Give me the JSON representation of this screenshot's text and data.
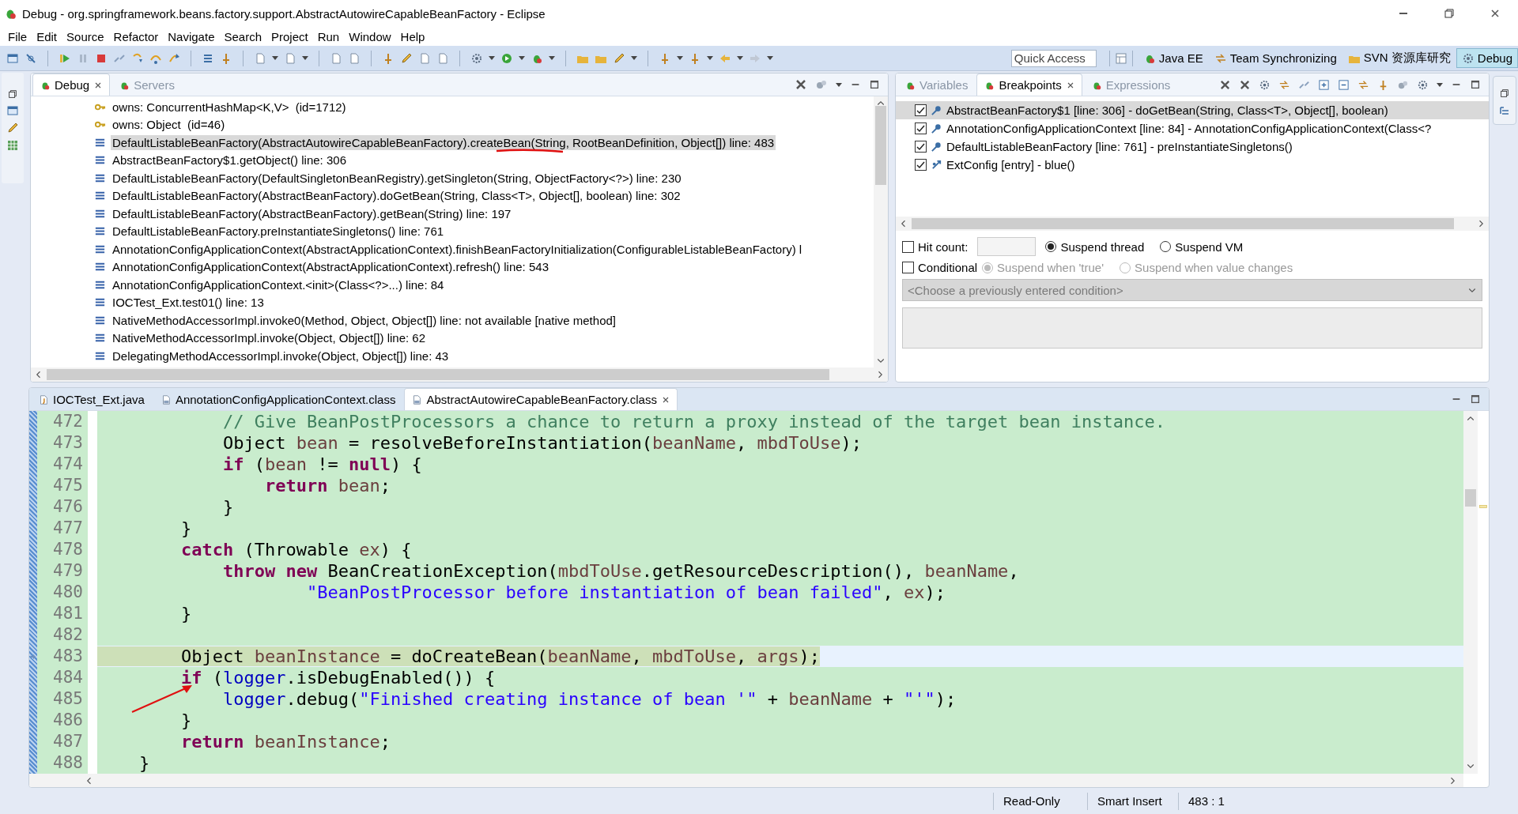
{
  "window": {
    "title": "Debug - org.springframework.beans.factory.support.AbstractAutowireCapableBeanFactory - Eclipse"
  },
  "menu": [
    "File",
    "Edit",
    "Source",
    "Refactor",
    "Navigate",
    "Search",
    "Project",
    "Run",
    "Window",
    "Help"
  ],
  "toolbar": {
    "quick_access": {
      "placeholder": "Quick Access"
    },
    "perspectives": [
      {
        "label": "Java EE",
        "selected": false
      },
      {
        "label": "Team Synchronizing",
        "selected": false
      },
      {
        "label": "SVN 资源库研究",
        "selected": false
      },
      {
        "label": "Debug",
        "selected": true
      }
    ]
  },
  "debug_view": {
    "tabs": [
      {
        "label": "Debug",
        "selected": true,
        "closable": true
      },
      {
        "label": "Servers",
        "selected": false,
        "closable": false
      }
    ],
    "items": [
      {
        "kind": "monitor",
        "text": "owns: ConcurrentHashMap<K,V>  (id=1712)",
        "selected": false
      },
      {
        "kind": "monitor",
        "text": "owns: Object  (id=46)",
        "selected": false
      },
      {
        "kind": "frame",
        "text": "DefaultListableBeanFactory(AbstractAutowireCapableBeanFactory).createBean(String, RootBeanDefinition, Object[]) line: 483",
        "selected": true
      },
      {
        "kind": "frame",
        "text": "AbstractBeanFactory$1.getObject() line: 306",
        "selected": false
      },
      {
        "kind": "frame",
        "text": "DefaultListableBeanFactory(DefaultSingletonBeanRegistry).getSingleton(String, ObjectFactory<?>) line: 230",
        "selected": false
      },
      {
        "kind": "frame",
        "text": "DefaultListableBeanFactory(AbstractBeanFactory).doGetBean(String, Class<T>, Object[], boolean) line: 302",
        "selected": false
      },
      {
        "kind": "frame",
        "text": "DefaultListableBeanFactory(AbstractBeanFactory).getBean(String) line: 197",
        "selected": false
      },
      {
        "kind": "frame",
        "text": "DefaultListableBeanFactory.preInstantiateSingletons() line: 761",
        "selected": false
      },
      {
        "kind": "frame",
        "text": "AnnotationConfigApplicationContext(AbstractApplicationContext).finishBeanFactoryInitialization(ConfigurableListableBeanFactory) l",
        "selected": false
      },
      {
        "kind": "frame",
        "text": "AnnotationConfigApplicationContext(AbstractApplicationContext).refresh() line: 543",
        "selected": false
      },
      {
        "kind": "frame",
        "text": "AnnotationConfigApplicationContext.<init>(Class<?>...) line: 84",
        "selected": false
      },
      {
        "kind": "frame",
        "text": "IOCTest_Ext.test01() line: 13",
        "selected": false
      },
      {
        "kind": "frame",
        "text": "NativeMethodAccessorImpl.invoke0(Method, Object, Object[]) line: not available [native method]",
        "selected": false
      },
      {
        "kind": "frame",
        "text": "NativeMethodAccessorImpl.invoke(Object, Object[]) line: 62",
        "selected": false
      },
      {
        "kind": "frame",
        "text": "DelegatingMethodAccessorImpl.invoke(Object, Object[]) line: 43",
        "selected": false
      }
    ]
  },
  "breakpoints_view": {
    "tabs": [
      {
        "label": "Variables",
        "selected": false,
        "closable": false
      },
      {
        "label": "Breakpoints",
        "selected": true,
        "closable": true
      },
      {
        "label": "Expressions",
        "selected": false,
        "closable": false
      }
    ],
    "items": [
      {
        "kind": "line",
        "text": "AbstractBeanFactory$1 [line: 306] - doGetBean(String, Class<T>, Object[], boolean)",
        "checked": true,
        "selected": true
      },
      {
        "kind": "line",
        "text": "AnnotationConfigApplicationContext [line: 84] - AnnotationConfigApplicationContext(Class<?",
        "checked": true,
        "selected": false
      },
      {
        "kind": "line",
        "text": "DefaultListableBeanFactory [line: 761] - preInstantiateSingletons()",
        "checked": true,
        "selected": false
      },
      {
        "kind": "entry",
        "text": "ExtConfig [entry] - blue()",
        "checked": true,
        "selected": false
      }
    ],
    "hit_count": {
      "label": "Hit count:",
      "checked": false
    },
    "suspend_options": [
      {
        "label": "Suspend thread",
        "selected": true
      },
      {
        "label": "Suspend VM",
        "selected": false
      }
    ],
    "conditional": {
      "label": "Conditional",
      "checked": false
    },
    "condition_options": [
      {
        "label": "Suspend when 'true'",
        "selected": true,
        "disabled": true
      },
      {
        "label": "Suspend when value changes",
        "selected": false,
        "disabled": true
      }
    ],
    "condition_history": {
      "placeholder": "<Choose a previously entered condition>",
      "disabled": true
    }
  },
  "editor": {
    "tabs": [
      {
        "label": "IOCTest_Ext.java",
        "kind": "java",
        "selected": false,
        "closable": false
      },
      {
        "label": "AnnotationConfigApplicationContext.class",
        "kind": "class",
        "selected": false,
        "closable": false
      },
      {
        "label": "AbstractAutowireCapableBeanFactory.class",
        "kind": "class",
        "selected": true,
        "closable": true
      }
    ],
    "lines": [
      {
        "number": "472",
        "current": false,
        "tokens": [
          {
            "kind": "comment",
            "text": "            // Give BeanPostProcessors a chance to return a proxy instead of the target bean instance."
          }
        ]
      },
      {
        "number": "473",
        "current": false,
        "tokens": [
          {
            "kind": "plain",
            "text": "            Object "
          },
          {
            "kind": "local",
            "text": "bean"
          },
          {
            "kind": "plain",
            "text": " = resolveBeforeInstantiation("
          },
          {
            "kind": "local",
            "text": "beanName"
          },
          {
            "kind": "plain",
            "text": ", "
          },
          {
            "kind": "local",
            "text": "mbdToUse"
          },
          {
            "kind": "plain",
            "text": ");"
          }
        ]
      },
      {
        "number": "474",
        "current": false,
        "tokens": [
          {
            "kind": "keyword",
            "text": "            if"
          },
          {
            "kind": "plain",
            "text": " ("
          },
          {
            "kind": "local",
            "text": "bean"
          },
          {
            "kind": "plain",
            "text": " != "
          },
          {
            "kind": "keyword",
            "text": "null"
          },
          {
            "kind": "plain",
            "text": ") {"
          }
        ]
      },
      {
        "number": "475",
        "current": false,
        "tokens": [
          {
            "kind": "keyword",
            "text": "                return"
          },
          {
            "kind": "local",
            "text": " bean"
          },
          {
            "kind": "plain",
            "text": ";"
          }
        ]
      },
      {
        "number": "476",
        "current": false,
        "tokens": [
          {
            "kind": "plain",
            "text": "            }"
          }
        ]
      },
      {
        "number": "477",
        "current": false,
        "tokens": [
          {
            "kind": "plain",
            "text": "        }"
          }
        ]
      },
      {
        "number": "478",
        "current": false,
        "tokens": [
          {
            "kind": "keyword",
            "text": "        catch"
          },
          {
            "kind": "plain",
            "text": " (Throwable "
          },
          {
            "kind": "local",
            "text": "ex"
          },
          {
            "kind": "plain",
            "text": ") {"
          }
        ]
      },
      {
        "number": "479",
        "current": false,
        "tokens": [
          {
            "kind": "keyword",
            "text": "            throw"
          },
          {
            "kind": "keyword",
            "text": " new"
          },
          {
            "kind": "plain",
            "text": " BeanCreationException("
          },
          {
            "kind": "local",
            "text": "mbdToUse"
          },
          {
            "kind": "plain",
            "text": ".getResourceDescription(), "
          },
          {
            "kind": "local",
            "text": "beanName"
          },
          {
            "kind": "plain",
            "text": ","
          }
        ]
      },
      {
        "number": "480",
        "current": false,
        "tokens": [
          {
            "kind": "string",
            "text": "                    \"BeanPostProcessor before instantiation of bean failed\""
          },
          {
            "kind": "plain",
            "text": ", "
          },
          {
            "kind": "local",
            "text": "ex"
          },
          {
            "kind": "plain",
            "text": ");"
          }
        ]
      },
      {
        "number": "481",
        "current": false,
        "tokens": [
          {
            "kind": "plain",
            "text": "        }"
          }
        ]
      },
      {
        "number": "482",
        "current": false
      },
      {
        "number": "483",
        "current": true,
        "tokens": [
          {
            "kind": "plain",
            "text": "        Object "
          },
          {
            "kind": "local",
            "text": "beanInstance"
          },
          {
            "kind": "plain",
            "text": " = doCreateBean("
          },
          {
            "kind": "local",
            "text": "beanName"
          },
          {
            "kind": "plain",
            "text": ", "
          },
          {
            "kind": "local",
            "text": "mbdToUse"
          },
          {
            "kind": "plain",
            "text": ", "
          },
          {
            "kind": "local",
            "text": "args"
          },
          {
            "kind": "plain",
            "text": ");"
          }
        ]
      },
      {
        "number": "484",
        "current": false,
        "tokens": [
          {
            "kind": "keyword",
            "text": "        if"
          },
          {
            "kind": "plain",
            "text": " ("
          },
          {
            "kind": "field",
            "text": "logger"
          },
          {
            "kind": "plain",
            "text": ".isDebugEnabled()) {"
          }
        ]
      },
      {
        "number": "485",
        "current": false,
        "tokens": [
          {
            "kind": "field",
            "text": "            logger"
          },
          {
            "kind": "plain",
            "text": ".debug("
          },
          {
            "kind": "string",
            "text": "\"Finished creating instance of bean '\""
          },
          {
            "kind": "plain",
            "text": " + "
          },
          {
            "kind": "local",
            "text": "beanName"
          },
          {
            "kind": "plain",
            "text": " + "
          },
          {
            "kind": "string",
            "text": "\"'\""
          },
          {
            "kind": "plain",
            "text": ");"
          }
        ]
      },
      {
        "number": "486",
        "current": false,
        "tokens": [
          {
            "kind": "plain",
            "text": "        }"
          }
        ]
      },
      {
        "number": "487",
        "current": false,
        "tokens": [
          {
            "kind": "keyword",
            "text": "        return"
          },
          {
            "kind": "local",
            "text": " beanInstance"
          },
          {
            "kind": "plain",
            "text": ";"
          }
        ]
      },
      {
        "number": "488",
        "current": false,
        "tokens": [
          {
            "kind": "plain",
            "text": "    }"
          }
        ]
      }
    ]
  },
  "status_bar": [
    "Read-Only",
    "Smart Insert",
    "483 : 1"
  ]
}
